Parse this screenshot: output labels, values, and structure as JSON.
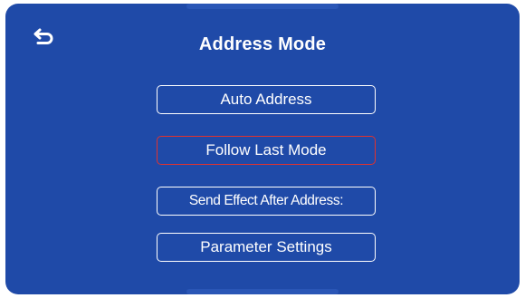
{
  "header": {
    "title": "Address Mode",
    "back_icon": "back-arrow-icon"
  },
  "menu": {
    "items": [
      {
        "label": "Auto Address",
        "selected": false
      },
      {
        "label": "Follow Last Mode",
        "selected": true
      },
      {
        "label": "Send Effect After Address:",
        "selected": false
      },
      {
        "label": "Parameter Settings",
        "selected": false
      }
    ]
  },
  "colors": {
    "background": "#1f4aa8",
    "text": "#ffffff",
    "button_border": "#ffffff",
    "selected_border": "#e0322e"
  }
}
